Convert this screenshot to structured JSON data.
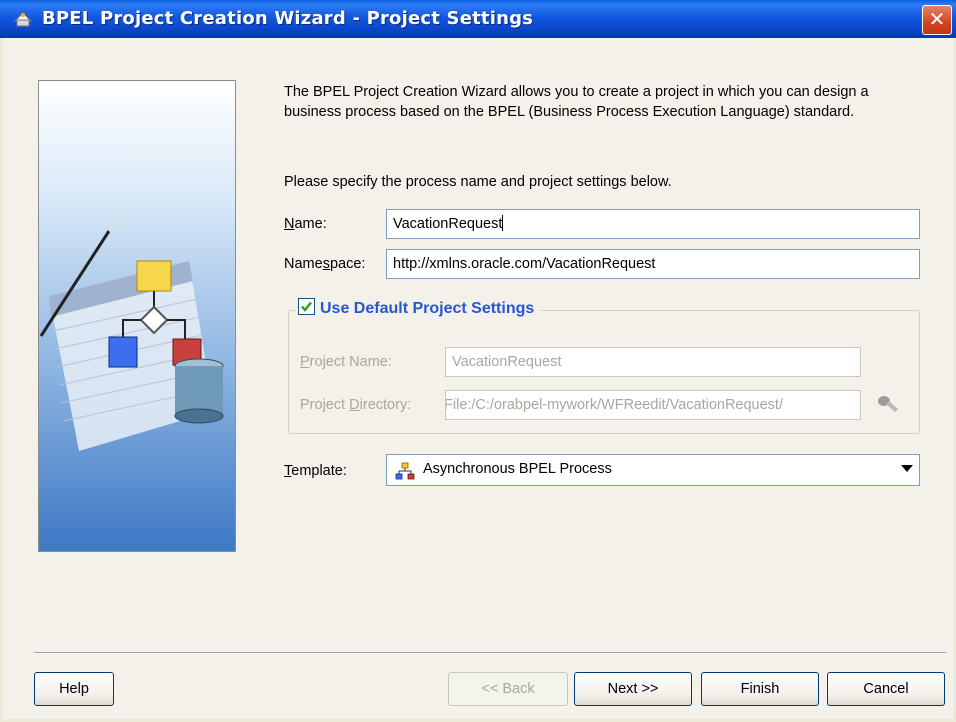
{
  "window": {
    "title": "BPEL Project Creation Wizard - Project Settings",
    "close_glyph": "✕"
  },
  "intro": {
    "paragraph": "The BPEL Project Creation Wizard allows you to create a project in which you can design a business process based on the BPEL (Business Process Execution Language) standard.",
    "instruction": "Please specify the process name and project settings below."
  },
  "form": {
    "name_label_pre": "",
    "name_label_mn": "N",
    "name_label_post": "ame:",
    "name_value": "VacationRequest",
    "namespace_label_pre": "Name",
    "namespace_label_mn": "s",
    "namespace_label_post": "pace:",
    "namespace_value": "http://xmlns.oracle.com/VacationRequest",
    "use_default_label": "Use Default Project Settings",
    "use_default_checked": true,
    "project_name_label_pre": "",
    "project_name_label_mn": "P",
    "project_name_label_post": "roject Name:",
    "project_name_value": "VacationRequest",
    "project_dir_label_pre": "Project ",
    "project_dir_label_mn": "D",
    "project_dir_label_post": "irectory:",
    "project_dir_value": "File:/C:/orabpel-mywork/WFReedit/VacationRequest/",
    "template_label_pre": "",
    "template_label_mn": "T",
    "template_label_post": "emplate:",
    "template_value": "Asynchronous BPEL Process"
  },
  "buttons": {
    "help": "Help",
    "back": "<< Back",
    "next": "Next >>",
    "finish": "Finish",
    "cancel": "Cancel"
  },
  "icons": {
    "title": "bpel-wizard-icon",
    "browse": "flashlight-icon",
    "template": "process-diagram-icon"
  },
  "colors": {
    "titlebar": "#1257df",
    "legend": "#2458d2",
    "close": "#d2431f"
  }
}
